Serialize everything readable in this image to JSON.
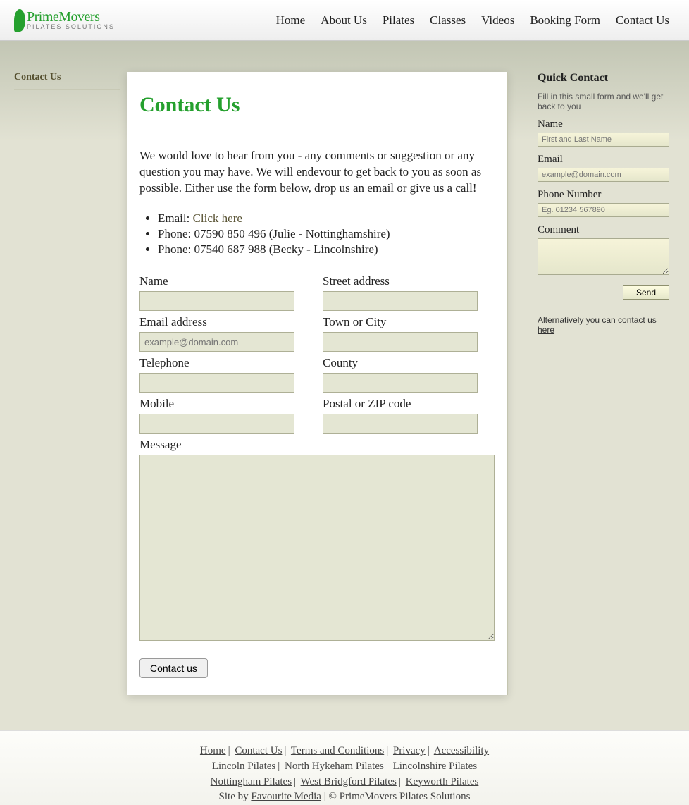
{
  "logo": {
    "name": "PrimeMovers",
    "sub": "PILATES SOLUTIONS"
  },
  "nav": [
    "Home",
    "About Us",
    "Pilates",
    "Classes",
    "Videos",
    "Booking Form",
    "Contact Us"
  ],
  "leftcol": {
    "title": "Contact Us"
  },
  "main": {
    "title": "Contact Us",
    "intro": "We would love to hear from you - any comments or suggestion or any question you may have. We will endevour to get back to you as soon as possible. Either use the form below, drop us an email or give us a call!",
    "bullets": {
      "email_label": "Email: ",
      "email_link": "Click here",
      "phone1": "Phone: 07590 850 496 (Julie - Nottinghamshire)",
      "phone2": "Phone: 07540 687 988 (Becky - Lincolnshire)"
    },
    "form": {
      "name": "Name",
      "email": "Email address",
      "email_ph": "example@domain.com",
      "tel": "Telephone",
      "mobile": "Mobile",
      "street": "Street address",
      "town": "Town or City",
      "county": "County",
      "zip": "Postal or ZIP code",
      "message": "Message",
      "submit": "Contact us"
    }
  },
  "quick": {
    "title": "Quick Contact",
    "sub": "Fill in this small form and we'll get back to you",
    "name": "Name",
    "name_ph": "First and Last Name",
    "email": "Email",
    "email_ph": "example@domain.com",
    "phone": "Phone Number",
    "phone_ph": "Eg. 01234 567890",
    "comment": "Comment",
    "send": "Send",
    "alt_pre": "Alternatively you can contact us ",
    "alt_link": "here"
  },
  "footer": {
    "row1": [
      "Home",
      "Contact Us",
      "Terms and Conditions",
      "Privacy",
      "Accessibility"
    ],
    "row2": [
      "Lincoln Pilates",
      "North Hykeham Pilates",
      "Lincolnshire Pilates"
    ],
    "row3": [
      "Nottingham Pilates",
      "West Bridgford Pilates",
      "Keyworth Pilates"
    ],
    "site_by_pre": "Site by ",
    "site_by_link": "Favourite Media",
    "copy": " | © PrimeMovers Pilates Solutions"
  }
}
